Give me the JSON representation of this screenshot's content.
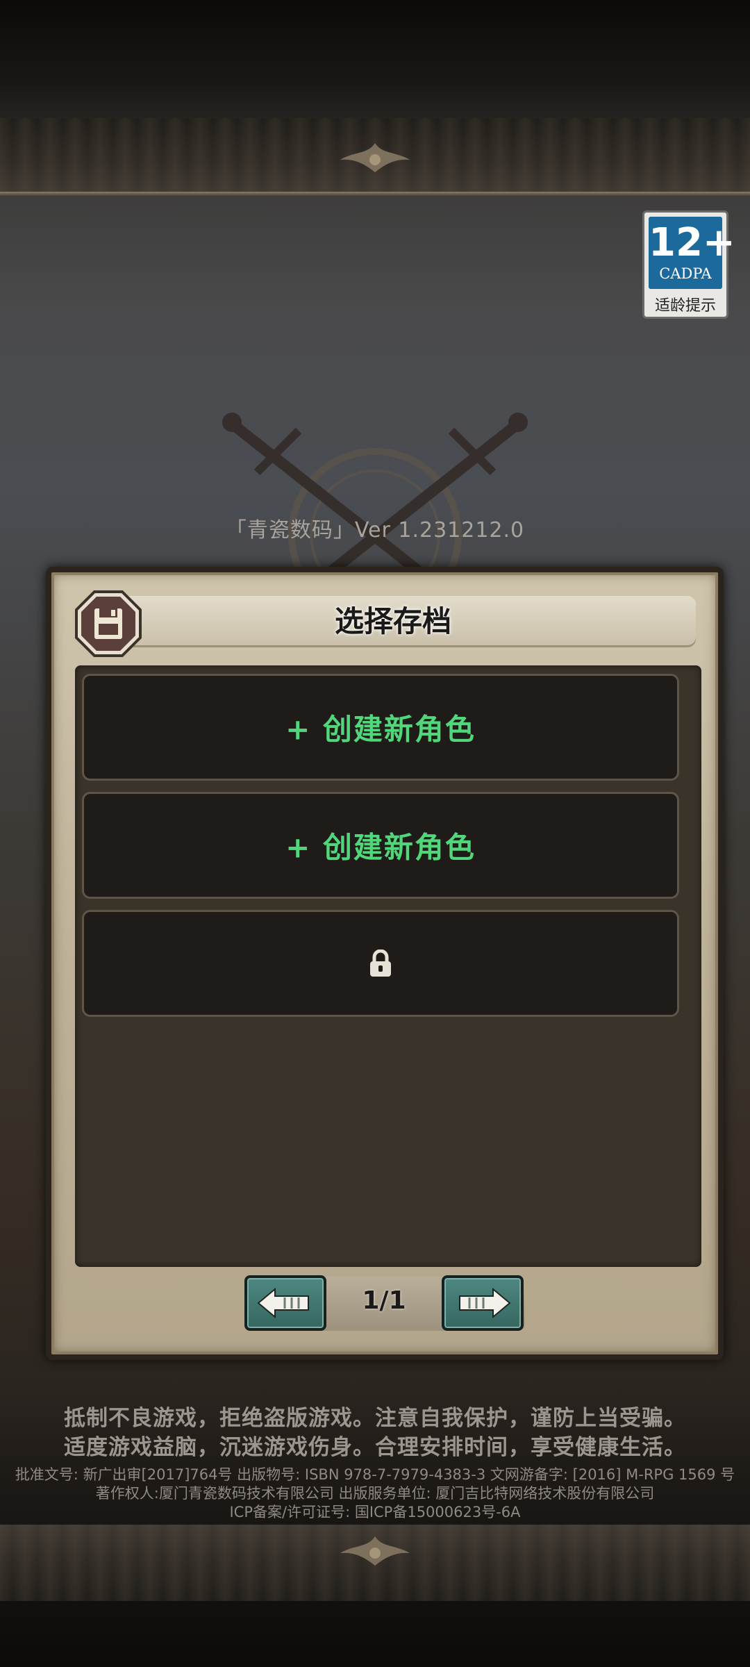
{
  "version": "「青瓷数码」Ver 1.231212.0",
  "age_rating": {
    "age": "12+",
    "org": "CADPA",
    "label": "适龄提示",
    "color": "#1c6a9c"
  },
  "dialog": {
    "title": "选择存档",
    "icon": "floppy-disk-icon",
    "slots": [
      {
        "label": "+ 创建新角色",
        "state": "empty"
      },
      {
        "label": "+ 创建新角色",
        "state": "empty"
      },
      {
        "label": "",
        "state": "locked",
        "icon": "lock-icon"
      }
    ],
    "pager": {
      "indicator": "1/1",
      "prev_icon": "arrow-left-icon",
      "next_icon": "arrow-right-icon"
    }
  },
  "footer": {
    "notice_line1": "抵制不良游戏，拒绝盗版游戏。注意自我保护，谨防上当受骗。",
    "notice_line2": "适度游戏益脑，沉迷游戏伤身。合理安排时间，享受健康生活。",
    "legal_line1": "批准文号: 新广出审[2017]764号 出版物号: ISBN 978-7-7979-4383-3 文网游备字: [2016] M-RPG 1569 号",
    "legal_line2": "著作权人:厦门青瓷数码技术有限公司 出版服务单位: 厦门吉比特网络技术股份有限公司",
    "legal_line3": "ICP备案/许可证号: 国ICP备15000623号-6A"
  },
  "colors": {
    "create_text": "#52d67b",
    "slot_bg": "#1f1b18",
    "panel": "#bdb197",
    "nav_button": "#4e8782"
  }
}
